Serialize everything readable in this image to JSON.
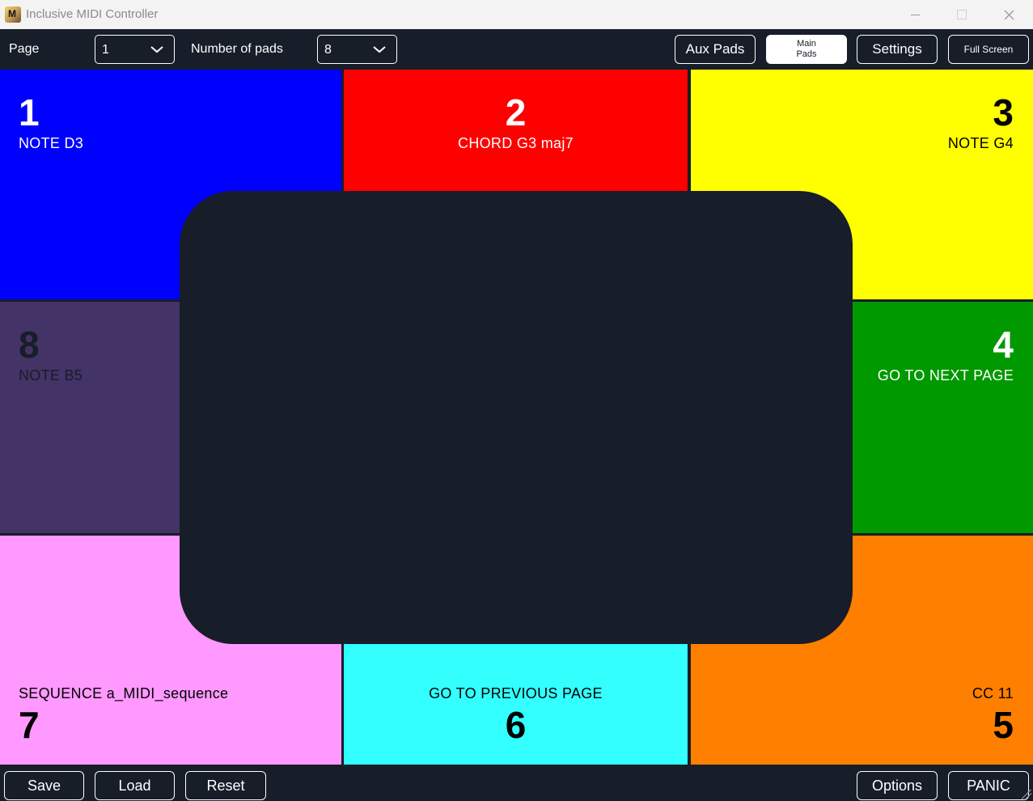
{
  "window": {
    "title": "Inclusive MIDI Controller",
    "icon_text": "M"
  },
  "toolbar": {
    "page_label": "Page",
    "page_value": "1",
    "num_pads_label": "Number of pads",
    "num_pads_value": "8",
    "aux_pads": "Aux Pads",
    "main_pads": "Main\nPads",
    "settings": "Settings",
    "full_screen": "Full Screen"
  },
  "pads": [
    {
      "number": "1",
      "label": "NOTE D3",
      "color": "#0000ff",
      "text_color": "#ffffff"
    },
    {
      "number": "2",
      "label": "CHORD G3 maj7",
      "color": "#ff0000",
      "text_color": "#ffffff"
    },
    {
      "number": "3",
      "label": "NOTE G4",
      "color": "#ffff00",
      "text_color": "#000000"
    },
    {
      "number": "4",
      "label": "GO TO NEXT PAGE",
      "color": "#009900",
      "text_color": "#ffffff"
    },
    {
      "number": "5",
      "label": "CC 11",
      "color": "#ff7f00",
      "text_color": "#000000"
    },
    {
      "number": "6",
      "label": "GO TO PREVIOUS PAGE",
      "color": "#33ffff",
      "text_color": "#000000"
    },
    {
      "number": "7",
      "label": "SEQUENCE a_MIDI_sequence",
      "color": "#ff99ff",
      "text_color": "#000000"
    },
    {
      "number": "8",
      "label": "NOTE B5",
      "color": "#433366",
      "text_color": "#171d29"
    }
  ],
  "bottombar": {
    "save": "Save",
    "load": "Load",
    "reset": "Reset",
    "options": "Options",
    "panic": "PANIC"
  },
  "icons": {
    "minimize": "minimize-icon",
    "maximize": "maximize-icon",
    "close": "close-icon",
    "chevron": "chevron-down-icon"
  }
}
